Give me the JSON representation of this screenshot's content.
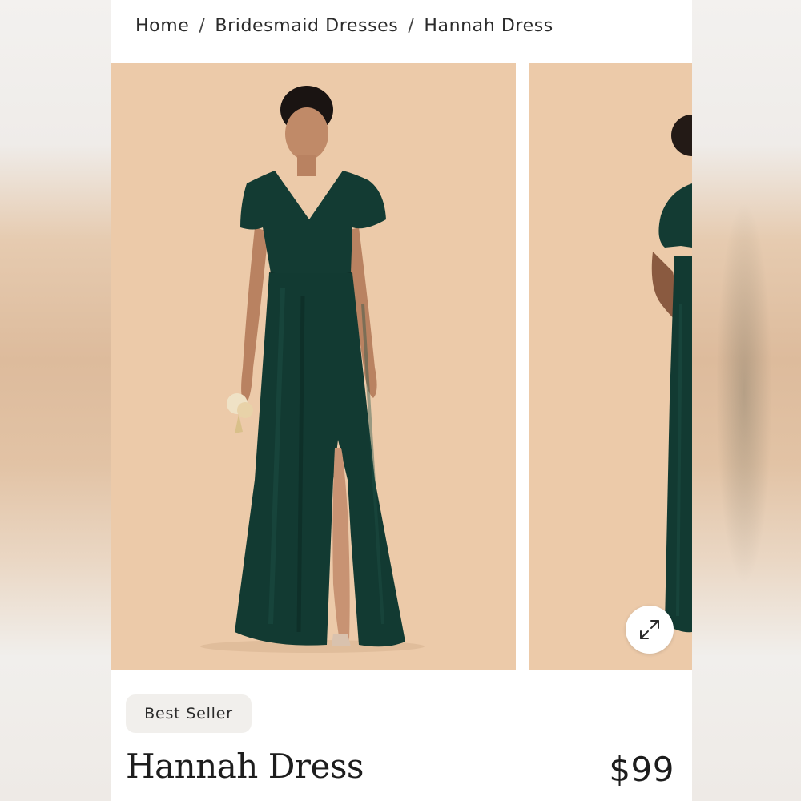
{
  "breadcrumb": {
    "items": [
      "Home",
      "Bridesmaid Dresses",
      "Hannah Dress"
    ],
    "separator": "/"
  },
  "gallery": {
    "background_color": "#eccaa9",
    "dress_color": "#123a32",
    "expand_icon": "expand-arrows-icon"
  },
  "product": {
    "badge": "Best Seller",
    "name": "Hannah Dress",
    "price": "$99"
  }
}
